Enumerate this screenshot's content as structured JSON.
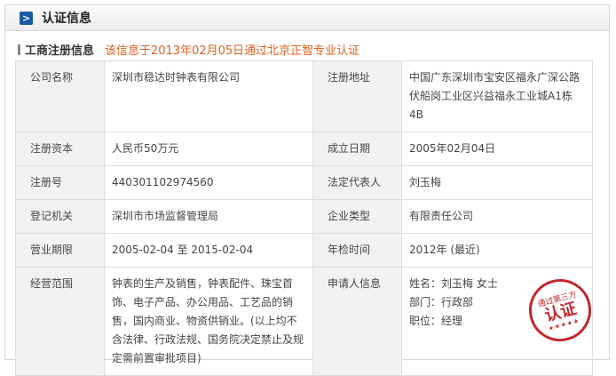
{
  "header": {
    "title": "认证信息",
    "icon": "chevron-right-icon"
  },
  "section": {
    "title": "工商注册信息",
    "note": "该信息于2013年02月05日通过北京正智专业认证",
    "note_color": "#e0601e"
  },
  "rows": [
    [
      {
        "label": "公司名称",
        "value": "深圳市稳达时钟表有限公司"
      },
      {
        "label": "注册地址",
        "value": "中国广东深圳市宝安区福永广深公路伏船岗工业区兴益福永工业城A1栋4B"
      }
    ],
    [
      {
        "label": "注册资本",
        "value": "人民币50万元"
      },
      {
        "label": "成立日期",
        "value": "2005年02月04日"
      }
    ],
    [
      {
        "label": "注册号",
        "value": "440301102974560"
      },
      {
        "label": "法定代表人",
        "value": "刘玉梅"
      }
    ],
    [
      {
        "label": "登记机关",
        "value": "深圳市市场监督管理局"
      },
      {
        "label": "企业类型",
        "value": "有限责任公司"
      }
    ],
    [
      {
        "label": "营业期限",
        "value": "2005-02-04 至 2015-02-04"
      },
      {
        "label": "年检时间",
        "value": "2012年 (最近)"
      }
    ]
  ],
  "scope": {
    "label": "经营范围",
    "value": "钟表的生产及销售，钟表配件、珠宝首饰、电子产品、办公用品、工艺品的销售，国内商业、物资供销业。(以上均不含法律、行政法规、国务院决定禁止及规定需前置审批项目)"
  },
  "applicant": {
    "label": "申请人信息",
    "name": "姓名：刘玉梅 女士",
    "dept": "部门：行政部",
    "title": "职位：经理"
  },
  "stamp": {
    "top": "通过第三方",
    "main": "认证",
    "stars": "★★★★★"
  }
}
